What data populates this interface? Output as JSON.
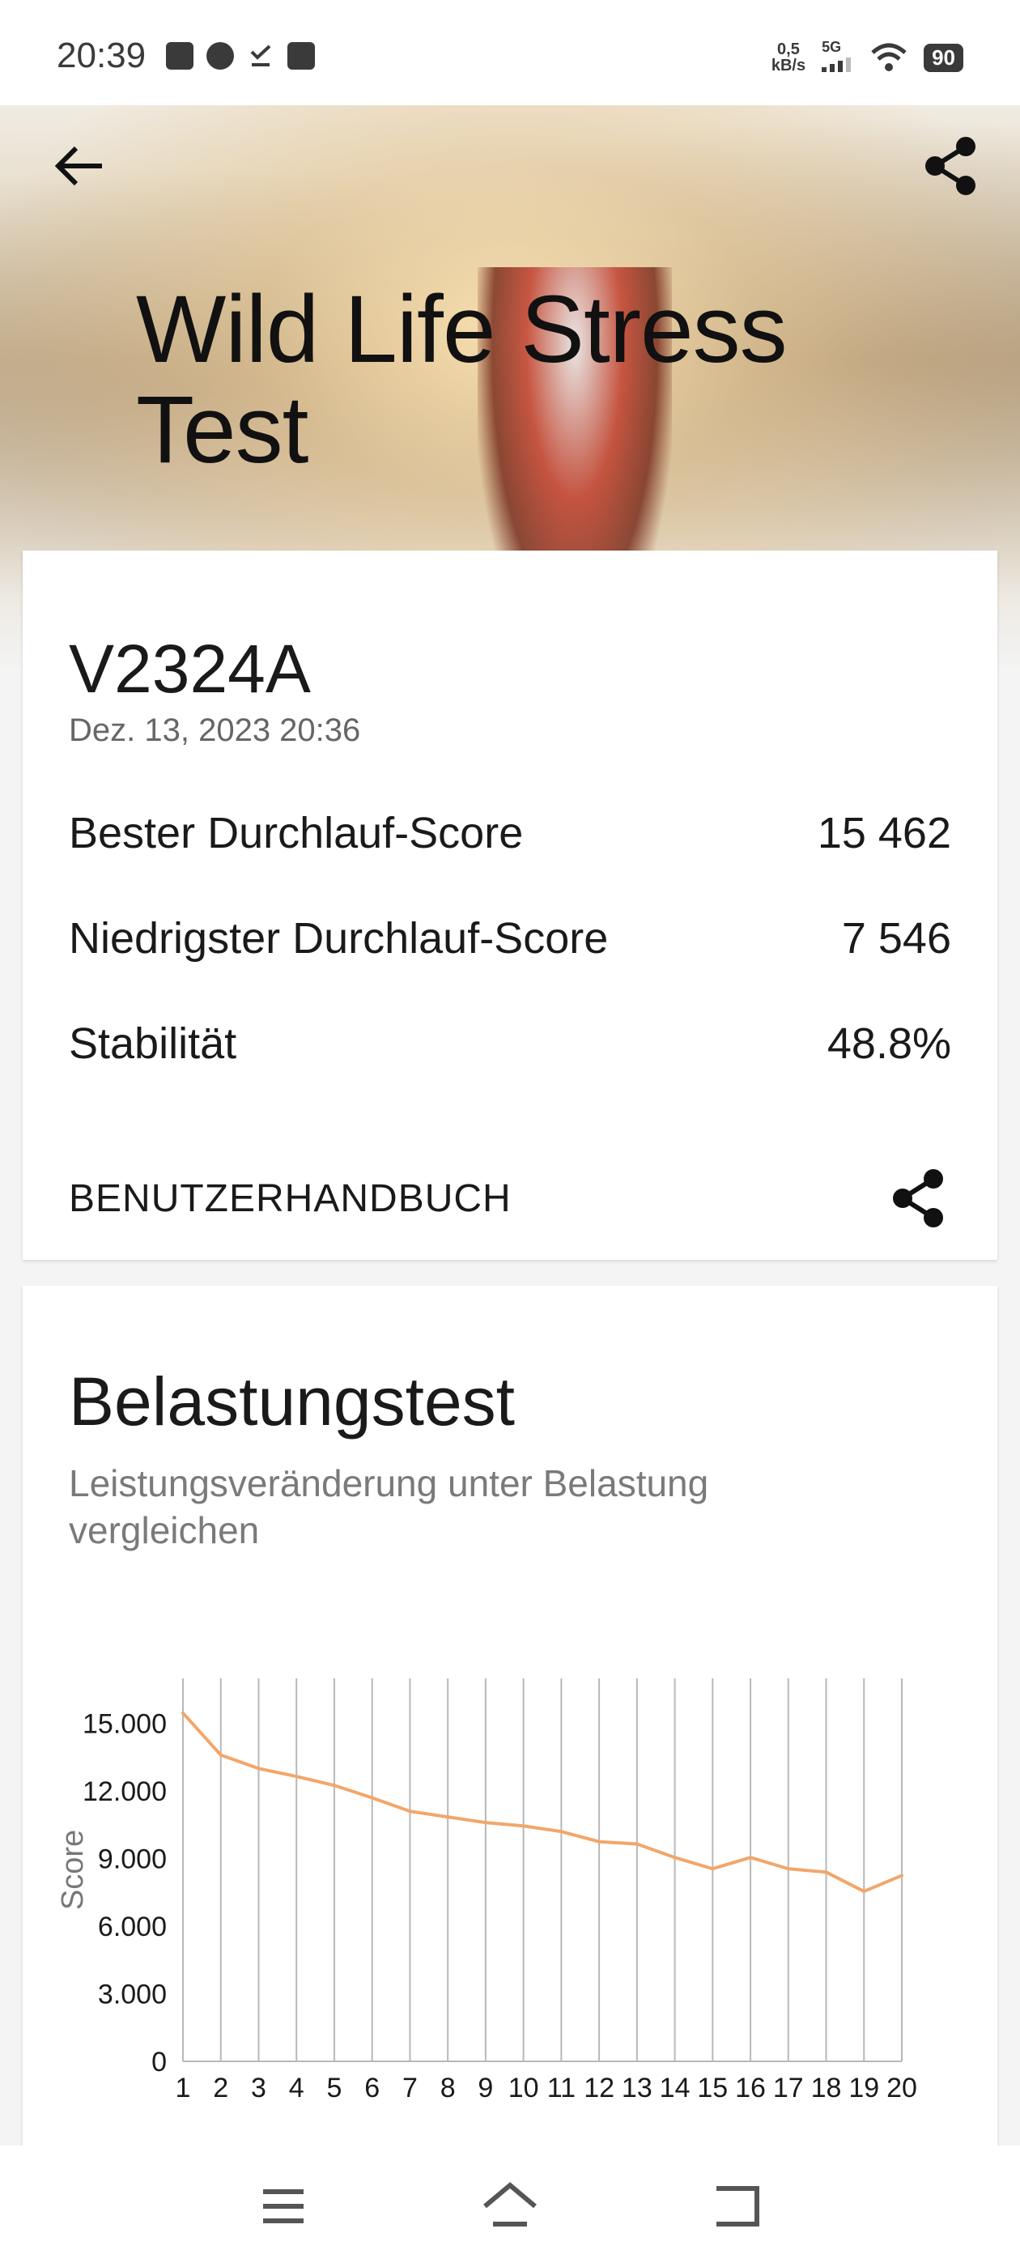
{
  "status_bar": {
    "time": "20:39",
    "net_speed_value": "0,5",
    "net_speed_unit": "kB/s",
    "signal": "5G",
    "battery": "90"
  },
  "header": {
    "title": "Wild Life Stress Test"
  },
  "summary": {
    "device": "V2324A",
    "date": "Dez. 13, 2023 20:36",
    "rows": [
      {
        "label": "Bester Durchlauf-Score",
        "value": "15 462"
      },
      {
        "label": "Niedrigster Durchlauf-Score",
        "value": "7 546"
      },
      {
        "label": "Stabilität",
        "value": "48.8%"
      }
    ],
    "manual_link": "BENUTZERHANDBUCH"
  },
  "stress_section": {
    "title": "Belastungstest",
    "subtitle": "Leistungsveränderung unter Belastung vergleichen"
  },
  "colors": {
    "line": "#f2a66a",
    "grid": "#b8b8b8",
    "text": "#1a1a1a"
  },
  "chart_data": {
    "type": "line",
    "ylabel": "Score",
    "xlabel": "",
    "x": [
      1,
      2,
      3,
      4,
      5,
      6,
      7,
      8,
      9,
      10,
      11,
      12,
      13,
      14,
      15,
      16,
      17,
      18,
      19,
      20
    ],
    "x_ticks": [
      "1",
      "2",
      "3",
      "4",
      "5",
      "6",
      "7",
      "8",
      "9",
      "10",
      "11",
      "12",
      "13",
      "14",
      "15",
      "16",
      "17",
      "18",
      "19",
      "20"
    ],
    "y_ticks": [
      0,
      3000,
      6000,
      9000,
      12000,
      15000
    ],
    "y_tick_labels": [
      "0",
      "3.000",
      "6.000",
      "9.000",
      "12.000",
      "15.000"
    ],
    "ylim": [
      0,
      17000
    ],
    "grid": "vertical",
    "values": [
      15462,
      13600,
      13000,
      12650,
      12250,
      11700,
      11100,
      10850,
      10600,
      10450,
      10200,
      9750,
      9650,
      9050,
      8550,
      9050,
      8550,
      8400,
      7546,
      8250
    ]
  }
}
